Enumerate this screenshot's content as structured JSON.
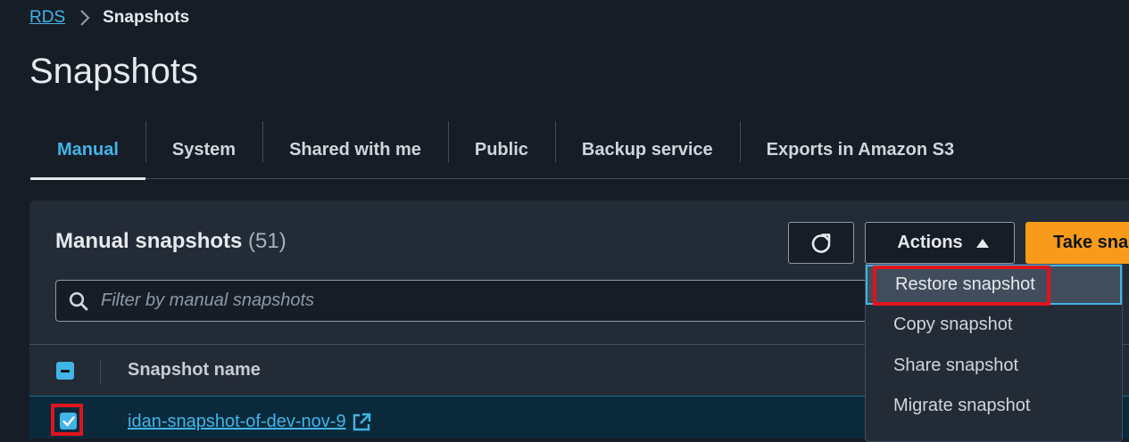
{
  "breadcrumb": {
    "root": "RDS",
    "current": "Snapshots"
  },
  "page": {
    "title": "Snapshots"
  },
  "tabs": [
    {
      "label": "Manual",
      "active": true
    },
    {
      "label": "System",
      "active": false
    },
    {
      "label": "Shared with me",
      "active": false
    },
    {
      "label": "Public",
      "active": false
    },
    {
      "label": "Backup service",
      "active": false
    },
    {
      "label": "Exports in Amazon S3",
      "active": false
    }
  ],
  "panel": {
    "title": "Manual snapshots",
    "count": "(51)",
    "actions_label": "Actions",
    "take_label": "Take snapshot",
    "filter_placeholder": "Filter by manual snapshots"
  },
  "table": {
    "columns": [
      "Snapshot name"
    ],
    "rows": [
      {
        "name": "idan-snapshot-of-dev-nov-9",
        "selected": true
      }
    ]
  },
  "actions_menu": {
    "items": [
      {
        "label": "Restore snapshot",
        "highlighted": true
      },
      {
        "label": "Copy snapshot",
        "highlighted": false
      },
      {
        "label": "Share snapshot",
        "highlighted": false
      },
      {
        "label": "Migrate snapshot",
        "highlighted": false
      }
    ]
  },
  "colors": {
    "background": "#161d26",
    "panel": "#232b37",
    "accent": "#42b4e6",
    "primary_button": "#f89b1a",
    "annotation": "#e0141e"
  }
}
